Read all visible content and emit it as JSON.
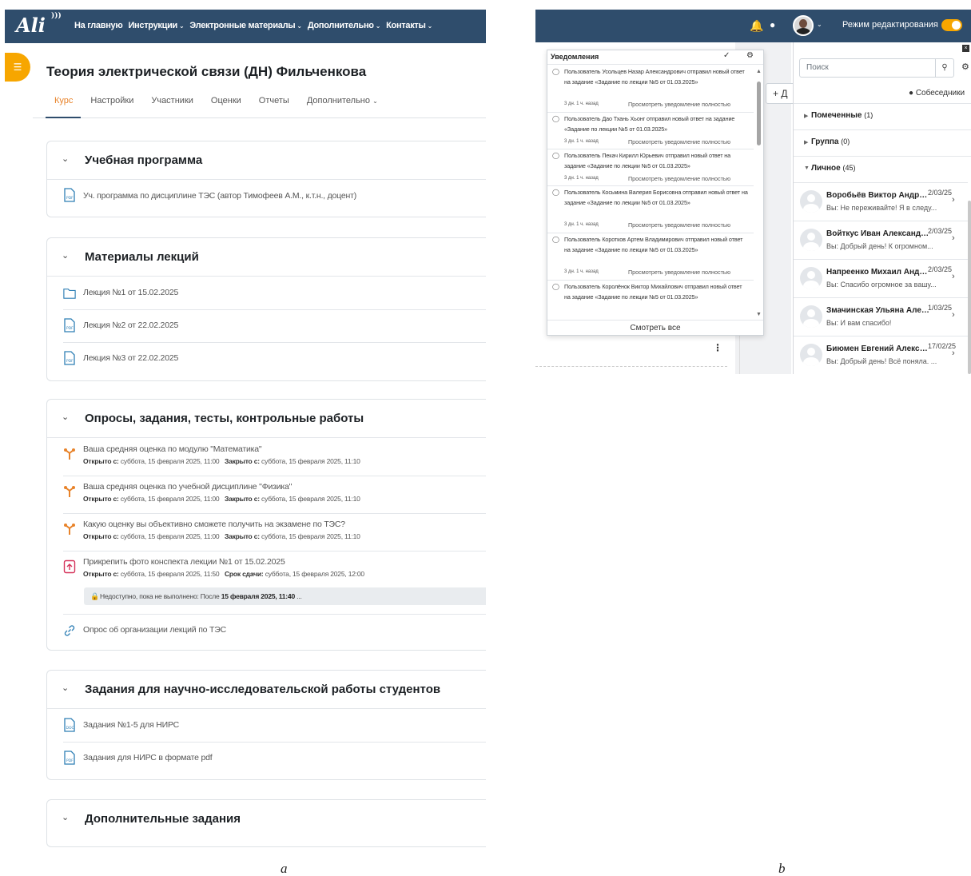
{
  "panel_a": {
    "logo_text": "Ali",
    "nav": [
      {
        "label": "На главную",
        "has_menu": false
      },
      {
        "label": "Инструкции",
        "has_menu": true
      },
      {
        "label": "Электронные материалы",
        "has_menu": true
      },
      {
        "label": "Дополнительно",
        "has_menu": true
      },
      {
        "label": "Контакты",
        "has_menu": true
      }
    ],
    "course_title": "Теория электрической связи (ДН) Фильченкова",
    "tabs": [
      "Курс",
      "Настройки",
      "Участники",
      "Оценки",
      "Отчеты",
      "Дополнительно"
    ],
    "sections": [
      {
        "title": "Учебная программа",
        "activities": [
          {
            "name": "Уч. программа по дисциплине ТЭС (автор Тимофеев А.М., к.т.н., доцент)"
          }
        ]
      },
      {
        "title": "Материалы лекций",
        "activities": [
          {
            "name": "Лекция №1 от 15.02.2025"
          },
          {
            "name": "Лекция №2 от 22.02.2025"
          },
          {
            "name": "Лекция №3 от 22.02.2025"
          }
        ]
      },
      {
        "title": "Опросы, задания, тесты, контрольные работы",
        "activities": [
          {
            "name": "Ваша средняя оценка по модулю \"Математика\"",
            "open_label": "Открыто с:",
            "open_value": "суббота, 15 февраля 2025, 11:00",
            "close_label": "Закрыто с:",
            "close_value": "суббота, 15 февраля 2025, 11:10"
          },
          {
            "name": "Ваша средняя оценка по учебной дисциплине \"Физика\"",
            "open_label": "Открыто с:",
            "open_value": "суббота, 15 февраля 2025, 11:00",
            "close_label": "Закрыто с:",
            "close_value": "суббота, 15 февраля 2025, 11:10"
          },
          {
            "name": "Какую оценку вы объективно сможете получить на экзамене по ТЭС?",
            "open_label": "Открыто с:",
            "open_value": "суббота, 15 февраля 2025, 11:00",
            "close_label": "Закрыто с:",
            "close_value": "суббота, 15 февраля 2025, 11:10"
          },
          {
            "name": "Прикрепить фото конспекта лекции №1 от 15.02.2025",
            "open_label": "Открыто с:",
            "open_value": "суббота, 15 февраля 2025, 11:50",
            "close_label": "Срок сдачи:",
            "close_value": "суббота, 15 февраля 2025, 12:00",
            "restriction_prefix": "Недоступно, пока не выполнено: После",
            "restriction_date": "15 февраля 2025, 11:40",
            "restriction_suffix": "..."
          },
          {
            "name": "Опрос об организации лекций по ТЭС"
          }
        ]
      },
      {
        "title": "Задания для научно-исследовательской работы студентов",
        "activities": [
          {
            "name": "Задания №1-5 для НИРС"
          },
          {
            "name": "Задания для НИРС в формате pdf"
          }
        ]
      },
      {
        "title": "Дополнительные задания",
        "activities": []
      }
    ],
    "figure_label": "a"
  },
  "panel_b": {
    "edit_mode_label": "Режим редактирования",
    "notifications": {
      "title": "Уведомления",
      "view_all": "Смотреть все",
      "items": [
        {
          "text": "Пользователь Усольцев Назар Александрович отправил новый ответ на задание «Задание по лекции №5 от 01.03.2025»",
          "time": "3 дн. 1 ч. назад",
          "more": "Просмотреть уведомление полностью"
        },
        {
          "text": "Пользователь Дао Тхань Хьонг отправил новый ответ на задание «Задание по лекции №5 от 01.03.2025»",
          "time": "3 дн. 1 ч. назад",
          "more": "Просмотреть уведомление полностью"
        },
        {
          "text": "Пользователь Пекач Кирилл Юрьевич отправил новый ответ на задание «Задание по лекции №5 от 01.03.2025»",
          "time": "3 дн. 1 ч. назад",
          "more": "Просмотреть уведомление полностью"
        },
        {
          "text": "Пользователь Косьмина Валерия Борисовна отправил новый ответ на задание «Задание по лекции №5 от 01.03.2025»",
          "time": "3 дн. 1 ч. назад",
          "more": "Просмотреть уведомление полностью"
        },
        {
          "text": "Пользователь Коротков Артем Владимирович отправил новый ответ на задание «Задание по лекции №5 от 01.03.2025»",
          "time": "3 дн. 1 ч. назад",
          "more": "Просмотреть уведомление полностью"
        },
        {
          "text": "Пользователь Королёнок Виктор Михайлович отправил новый ответ на задание «Задание по лекции №5 от 01.03.2025»",
          "time": "",
          "more": ""
        }
      ]
    },
    "add_button": "+ Д",
    "messaging": {
      "search_placeholder": "Поиск",
      "contacts_label": "Собеседники",
      "groups": [
        {
          "label": "Помеченные",
          "count": "(1)",
          "expanded": false
        },
        {
          "label": "Группа",
          "count": "(0)",
          "expanded": false
        },
        {
          "label": "Личное",
          "count": "(45)",
          "expanded": true
        }
      ],
      "conversations": [
        {
          "name": "Воробьёв Виктор Андреевич",
          "date": "2/03/25",
          "message": "Вы: Не переживайте! Я в следу..."
        },
        {
          "name": "Войткус Иван Александрович",
          "date": "2/03/25",
          "message": "Вы: Добрый день! К огромном..."
        },
        {
          "name": "Напреенко Михаил Андреевич",
          "date": "2/03/25",
          "message": "Вы: Спасибо огромное за вашу..."
        },
        {
          "name": "Змачинская Ульяна Александровна",
          "date": "1/03/25",
          "message": "Вы: И вам спасибо!"
        },
        {
          "name": "Биюмен Евгений Александрович",
          "date": "17/02/25",
          "message": "Вы: Добрый день! Всё поняла. ..."
        }
      ]
    },
    "figure_label": "b"
  },
  "icons": {
    "drawer": "list-icon",
    "bell": "bell-icon",
    "chat": "chat-bubble-icon",
    "pdf": "pdf-file-icon",
    "folder": "folder-icon",
    "choice": "choice-icon",
    "assignment": "assignment-upload-icon",
    "url": "link-icon",
    "lock": "lock-icon",
    "gear": "gear-icon",
    "search": "search-icon",
    "lightbulb": "lightbulb-icon",
    "user": "user-icon"
  },
  "colors": {
    "navbar": "#2f4d6c",
    "accent": "#f7a600",
    "tab_active": "#e8832a"
  }
}
